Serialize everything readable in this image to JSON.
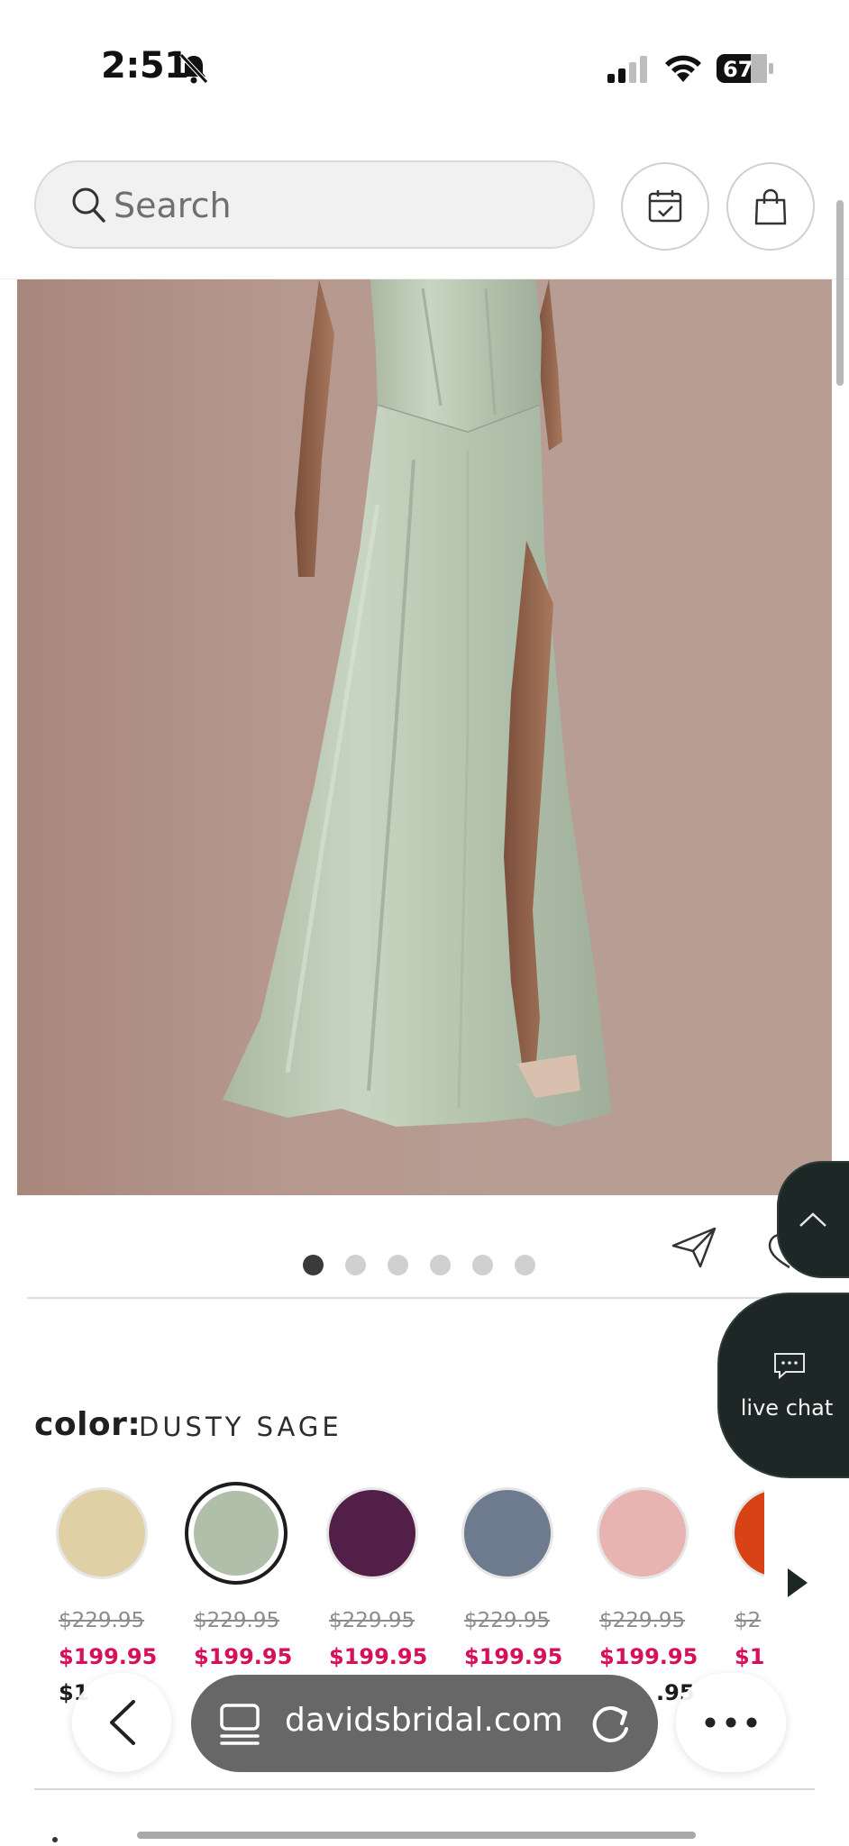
{
  "status_bar": {
    "time": "2:51",
    "battery": "67"
  },
  "header": {
    "search_placeholder": "Search"
  },
  "product": {
    "image_alt": "Model wearing a satin A-line gown with corset bodice and front slit"
  },
  "gallery": {
    "dot_count": 6,
    "active_index": 0
  },
  "color": {
    "label": "color:",
    "selected_name": "DUSTY SAGE",
    "swatches": [
      {
        "hex": "#dfd0a6",
        "price_old": "$229.95",
        "price_sale": "$199.95",
        "price_extra": "$1"
      },
      {
        "hex": "#b0bfa9",
        "price_old": "$229.95",
        "price_sale": "$199.95",
        "price_extra": ""
      },
      {
        "hex": "#521f49",
        "price_old": "$229.95",
        "price_sale": "$199.95",
        "price_extra": ""
      },
      {
        "hex": "#6e7b8e",
        "price_old": "$229.95",
        "price_sale": "$199.95",
        "price_extra": ""
      },
      {
        "hex": "#e8b4b1",
        "price_old": "$229.95",
        "price_sale": "$199.95",
        "price_extra": ".95"
      },
      {
        "hex": "#d84316",
        "price_old": "$2",
        "price_sale": "$1",
        "price_extra": ""
      }
    ]
  },
  "floating": {
    "live_chat_label": "live chat"
  },
  "browser": {
    "url": "davidsbridal.com"
  }
}
